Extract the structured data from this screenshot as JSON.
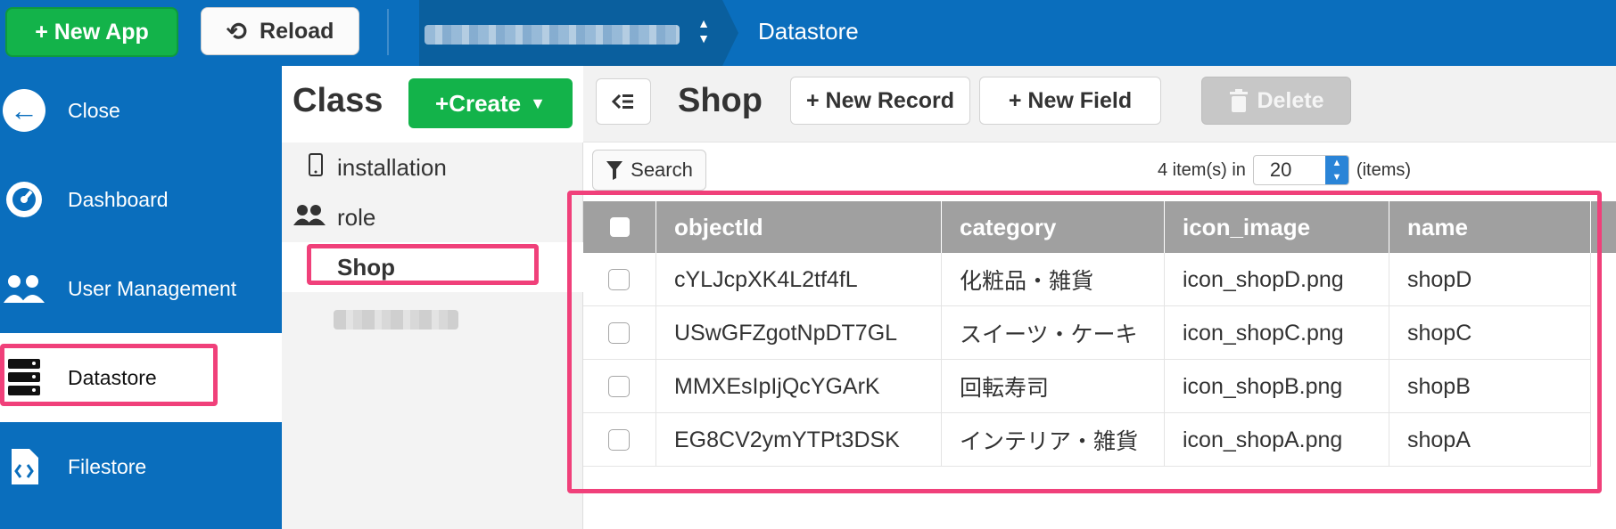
{
  "topbar": {
    "new_app_label": "+ New App",
    "reload_label": "Reload",
    "breadcrumb": "Datastore"
  },
  "nav": {
    "items": [
      {
        "label": "Close",
        "icon": "arrow-left-circle-icon"
      },
      {
        "label": "Dashboard",
        "icon": "gauge-icon"
      },
      {
        "label": "User Management",
        "icon": "users-icon"
      },
      {
        "label": "Datastore",
        "icon": "database-icon"
      },
      {
        "label": "Filestore",
        "icon": "file-code-icon"
      }
    ],
    "active": "Datastore"
  },
  "classpanel": {
    "title": "Class",
    "create_label": "+Create",
    "classes": [
      {
        "label": "installation",
        "icon": "mobile-icon"
      },
      {
        "label": "role",
        "icon": "users-icon"
      },
      {
        "label": "Shop",
        "icon": ""
      }
    ],
    "selected": "Shop"
  },
  "main": {
    "title": "Shop",
    "new_record_label": "+ New Record",
    "new_field_label": "+ New Field",
    "delete_label": "Delete",
    "search_label": "Search",
    "items_count_text": "4 item(s) in",
    "per_page": "20",
    "items_suffix": "(items)"
  },
  "table": {
    "columns": [
      "objectId",
      "category",
      "icon_image",
      "name"
    ],
    "rows": [
      {
        "objectId": "cYLJcpXK4L2tf4fL",
        "category": "化粧品・雑貨",
        "icon_image": "icon_shopD.png",
        "name": "shopD"
      },
      {
        "objectId": "USwGFZgotNpDT7GL",
        "category": "スイーツ・ケーキ",
        "icon_image": "icon_shopC.png",
        "name": "shopC"
      },
      {
        "objectId": "MMXEsIpIjQcYGArK",
        "category": "回転寿司",
        "icon_image": "icon_shopB.png",
        "name": "shopB"
      },
      {
        "objectId": "EG8CV2ymYTPt3DSK",
        "category": "インテリア・雑貨",
        "icon_image": "icon_shopA.png",
        "name": "shopA"
      }
    ]
  },
  "colors": {
    "brand_blue": "#0a6ebd",
    "green": "#13b34a",
    "highlight": "#f0407a",
    "table_header": "#a0a0a0"
  }
}
